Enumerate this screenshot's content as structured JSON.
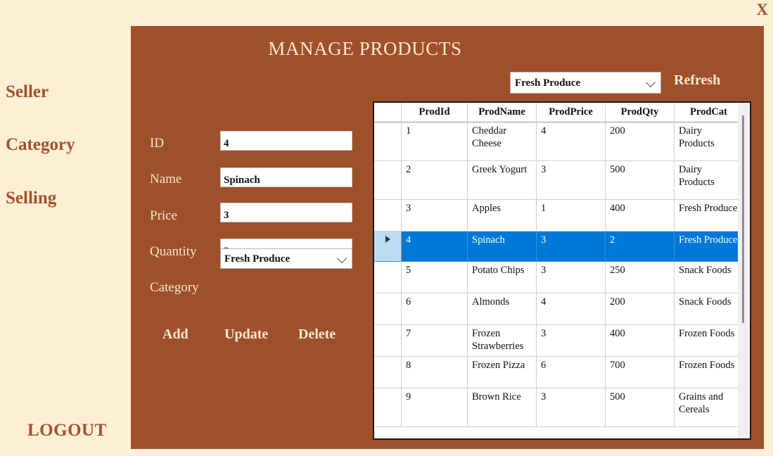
{
  "window": {
    "close_label": "X"
  },
  "sidebar": {
    "items": [
      {
        "label": "Seller"
      },
      {
        "label": "Category"
      },
      {
        "label": "Selling"
      }
    ],
    "logout_label": "LOGOUT"
  },
  "panel": {
    "title": "MANAGE PRODUCTS"
  },
  "filter": {
    "selected": "Fresh Produce",
    "refresh_label": "Refresh"
  },
  "form": {
    "fields": [
      {
        "label": "ID",
        "value": "4"
      },
      {
        "label": "Name",
        "value": "Spinach"
      },
      {
        "label": "Price",
        "value": "3"
      },
      {
        "label": "Quantity",
        "value": "2"
      }
    ],
    "category_label": "Category",
    "category_value": "Fresh Produce",
    "buttons": [
      {
        "label": "Add"
      },
      {
        "label": "Update"
      },
      {
        "label": "Delete"
      }
    ]
  },
  "grid": {
    "columns": [
      "ProdId",
      "ProdName",
      "ProdPrice",
      "ProdQty",
      "ProdCat"
    ],
    "rows": [
      {
        "ProdId": "1",
        "ProdName": "Cheddar Cheese",
        "ProdPrice": "4",
        "ProdQty": "200",
        "ProdCat": "Dairy Products"
      },
      {
        "ProdId": "2",
        "ProdName": "Greek Yogurt",
        "ProdPrice": "3",
        "ProdQty": "500",
        "ProdCat": "Dairy Products"
      },
      {
        "ProdId": "3",
        "ProdName": "Apples",
        "ProdPrice": "1",
        "ProdQty": "400",
        "ProdCat": "Fresh Produce"
      },
      {
        "ProdId": "4",
        "ProdName": "Spinach",
        "ProdPrice": "3",
        "ProdQty": "2",
        "ProdCat": "Fresh Produce",
        "selected": true
      },
      {
        "ProdId": "5",
        "ProdName": "Potato Chips",
        "ProdPrice": "3",
        "ProdQty": "250",
        "ProdCat": "Snack Foods"
      },
      {
        "ProdId": "6",
        "ProdName": "Almonds",
        "ProdPrice": "4",
        "ProdQty": "200",
        "ProdCat": "Snack Foods"
      },
      {
        "ProdId": "7",
        "ProdName": "Frozen Strawberries",
        "ProdPrice": "3",
        "ProdQty": "400",
        "ProdCat": "Frozen Foods"
      },
      {
        "ProdId": "8",
        "ProdName": "Frozen Pizza",
        "ProdPrice": "6",
        "ProdQty": "700",
        "ProdCat": "Frozen Foods"
      },
      {
        "ProdId": "9",
        "ProdName": "Brown Rice",
        "ProdPrice": "3",
        "ProdQty": "500",
        "ProdCat": "Grains and Cereals"
      }
    ]
  },
  "colors": {
    "background": "#fdeed6",
    "panel": "#9e502a",
    "accent_text": "#a0522d",
    "panel_text": "#fbe8d2",
    "selection": "#0078d7",
    "rowheader_selected": "#bcdcf4"
  }
}
